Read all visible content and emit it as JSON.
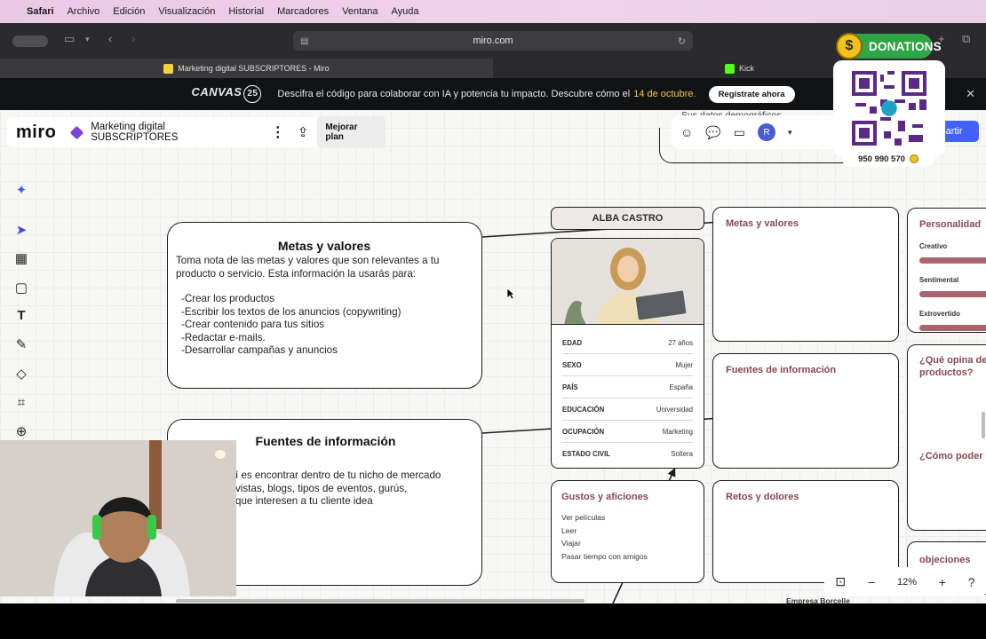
{
  "menubar": {
    "items": [
      "Safari",
      "Archivo",
      "Edición",
      "Visualización",
      "Historial",
      "Marcadores",
      "Ventana",
      "Ayuda"
    ]
  },
  "safari": {
    "url": "miro.com",
    "tabs": [
      {
        "label": "Marketing digital SUBSCRIPTORES - Miro"
      },
      {
        "label": "Kick"
      }
    ]
  },
  "banner": {
    "logo": "CANVAS",
    "logo_num": "25",
    "text": "Descifra el código para colaborar con IA y potencia tu impacto. Descubre cómo el",
    "date": "14 de octubre.",
    "cta": "Regístrate ahora"
  },
  "miro": {
    "logo": "miro",
    "board": "Marketing digital SUBSCRIPTORES",
    "plan": "Mejorar plan",
    "share": "partir",
    "avatar": "R",
    "behind_text": "Sus datos demográficos"
  },
  "metas": {
    "title": "Metas y valores",
    "body": "Toma nota de las metas y valores que son relevantes a tu producto o servicio. Esta información la usarás para:",
    "items": [
      "-Crear los productos",
      "-Escribir los textos de los anuncios (copywriting)",
      "-Crear contenido para tus sitios",
      "-Redactar e-mails.",
      "-Desarrollar campañas y anuncios"
    ]
  },
  "fuentes": {
    "title": "Fuentes de información",
    "lines": [
      "í es encontrar dentro de tu nicho de mercado",
      "vistas, blogs, tipos de eventos, gurús,",
      "que interesen a tu cliente idea"
    ]
  },
  "persona": {
    "name": "ALBA CASTRO",
    "rows": [
      {
        "k": "EDAD",
        "v": "27 años"
      },
      {
        "k": "SEXO",
        "v": "Mujer"
      },
      {
        "k": "PAÍS",
        "v": "España"
      },
      {
        "k": "EDUCACIÓN",
        "v": "Universidad"
      },
      {
        "k": "OCUPACIÓN",
        "v": "Marketing"
      },
      {
        "k": "ESTADO CIVIL",
        "v": "Soltera"
      }
    ],
    "metas_title": "Metas y valores",
    "fuentes_title": "Fuentes de información",
    "retos_title": "Retos y dolores",
    "gustos": {
      "title": "Gustos y aficiones",
      "items": [
        "Ver películas",
        "Leer",
        "Viajar",
        "Pasar tiempo con amigos"
      ]
    },
    "personalidad": {
      "title": "Personalidad",
      "traits": [
        "Creativo",
        "Sentimental",
        "Extrovertido"
      ]
    },
    "opina": "¿Qué opina de productos?",
    "como": "¿Cómo poder",
    "objeciones": "objeciones",
    "empresa": "Empresa Borcelle"
  },
  "zoom": {
    "level": "12%"
  },
  "donations": {
    "label": "DONATIONS",
    "phone": "950 990 570"
  }
}
